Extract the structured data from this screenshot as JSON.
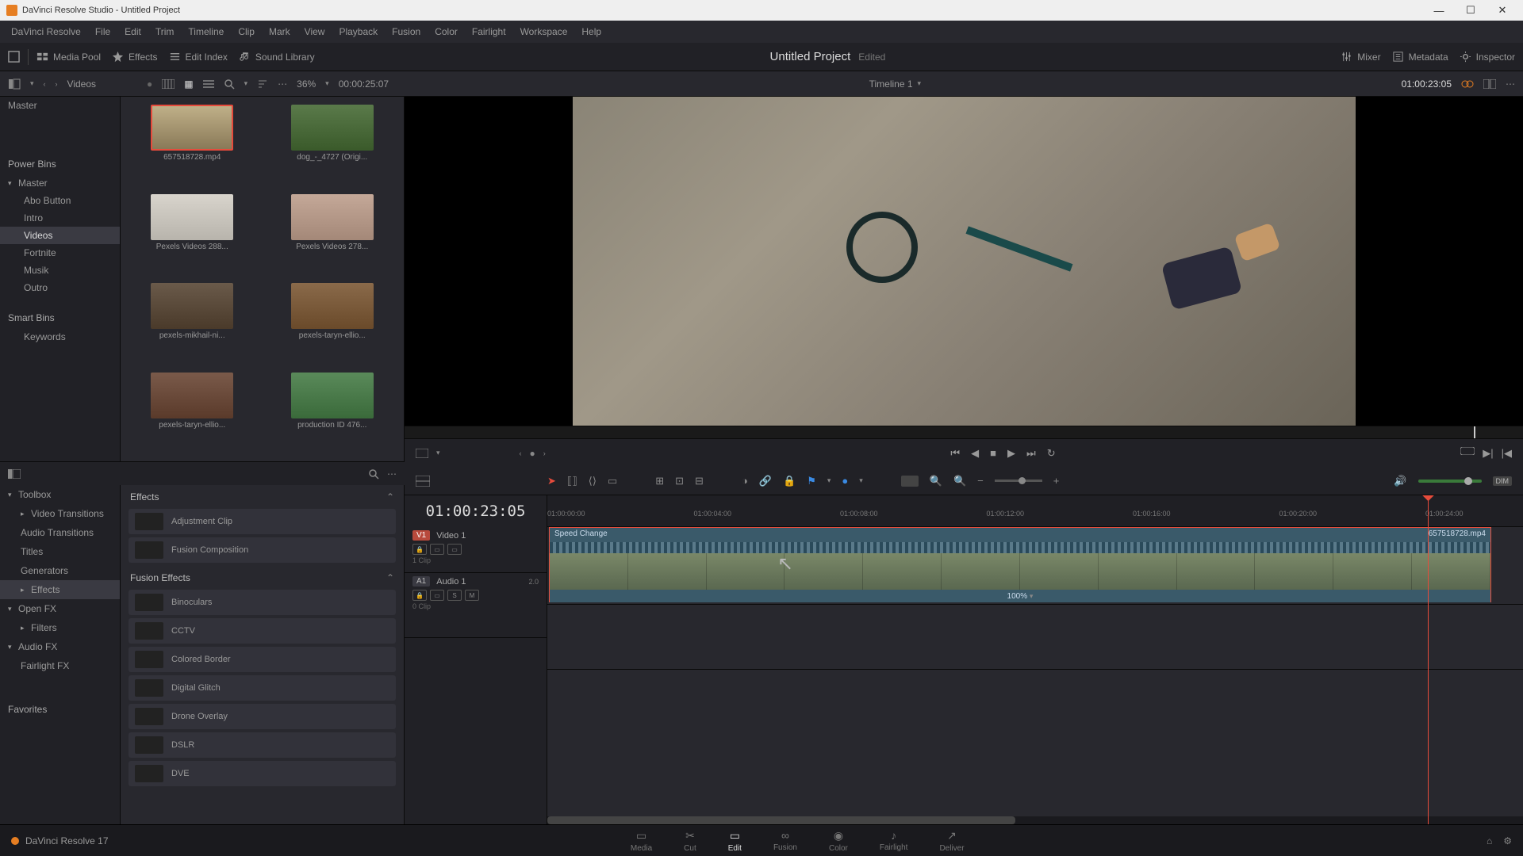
{
  "titlebar": {
    "title": "DaVinci Resolve Studio - Untitled Project"
  },
  "menubar": [
    "DaVinci Resolve",
    "File",
    "Edit",
    "Trim",
    "Timeline",
    "Clip",
    "Mark",
    "View",
    "Playback",
    "Fusion",
    "Color",
    "Fairlight",
    "Workspace",
    "Help"
  ],
  "toolbar": {
    "media_pool": "Media Pool",
    "effects": "Effects",
    "edit_index": "Edit Index",
    "sound_library": "Sound Library",
    "mixer": "Mixer",
    "metadata": "Metadata",
    "inspector": "Inspector"
  },
  "project": {
    "title": "Untitled Project",
    "edited": "Edited"
  },
  "secondary": {
    "pool_label": "Videos",
    "zoom": "36%",
    "src_tc": "00:00:25:07",
    "timeline_name": "Timeline 1",
    "rec_tc": "01:00:23:05"
  },
  "bins": {
    "master": "Master",
    "power_bins": "Power Bins",
    "pb_master": "Master",
    "pb_items": [
      "Abo Button",
      "Intro",
      "Videos",
      "Fortnite",
      "Musik",
      "Outro"
    ],
    "smart_bins": "Smart Bins",
    "sb_items": [
      "Keywords"
    ]
  },
  "media": [
    {
      "name": "657518728.mp4",
      "selected": true,
      "bg": "linear-gradient(#bfb088,#8a7a58)"
    },
    {
      "name": "dog_-_4727 (Origi...",
      "bg": "linear-gradient(#5a7a4a,#3a5a2a)"
    },
    {
      "name": "Pexels Videos 288...",
      "bg": "linear-gradient(#d8d4cc,#b8b4ac)"
    },
    {
      "name": "Pexels Videos 278...",
      "bg": "linear-gradient(#c4a898,#a48878)"
    },
    {
      "name": "pexels-mikhail-ni...",
      "bg": "linear-gradient(#6a5a4a,#4a3a2a)"
    },
    {
      "name": "pexels-taryn-ellio...",
      "bg": "linear-gradient(#8a6a4a,#6a4a2a)"
    },
    {
      "name": "pexels-taryn-ellio...",
      "bg": "linear-gradient(#7a5a4a,#5a3a2a)"
    },
    {
      "name": "production ID 476...",
      "bg": "linear-gradient(#5a8a5a,#3a6a3a)"
    }
  ],
  "effects_tree": {
    "toolbox": "Toolbox",
    "toolbox_items": [
      "Video Transitions",
      "Audio Transitions",
      "Titles",
      "Generators",
      "Effects"
    ],
    "open_fx": "Open FX",
    "open_fx_items": [
      "Filters"
    ],
    "audio_fx": "Audio FX",
    "audio_fx_items": [
      "Fairlight FX"
    ],
    "favorites": "Favorites"
  },
  "effects_panel": {
    "header1": "Effects",
    "list1": [
      "Adjustment Clip",
      "Fusion Composition"
    ],
    "header2": "Fusion Effects",
    "list2": [
      "Binoculars",
      "CCTV",
      "Colored Border",
      "Digital Glitch",
      "Drone Overlay",
      "DSLR",
      "DVE"
    ]
  },
  "timeline": {
    "big_tc": "01:00:23:05",
    "v1_badge": "V1",
    "v1_name": "Video 1",
    "v1_clips": "1 Clip",
    "a1_badge": "A1",
    "a1_name": "Audio 1",
    "a1_clips": "0 Clip",
    "a1_level": "2.0",
    "clip": {
      "speed_label": "Speed Change",
      "filename": "657518728.mp4",
      "speed_pct": "100%"
    },
    "ruler": [
      "01:00:00:00",
      "01:00:04:00",
      "01:00:08:00",
      "01:00:12:00",
      "01:00:16:00",
      "01:00:20:00",
      "01:00:24:00"
    ]
  },
  "pages": [
    "Media",
    "Cut",
    "Edit",
    "Fusion",
    "Color",
    "Fairlight",
    "Deliver"
  ],
  "app_version": "DaVinci Resolve 17"
}
